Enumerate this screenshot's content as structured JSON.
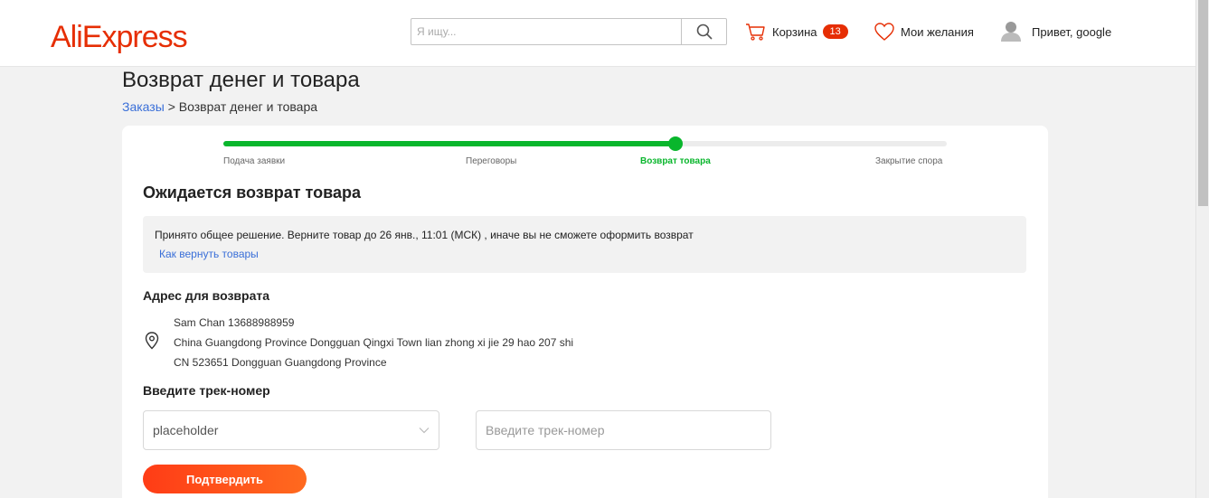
{
  "header": {
    "logo": "AliExpress",
    "search_placeholder": "Я ищу...",
    "cart_label": "Корзина",
    "cart_count": "13",
    "wishlist_label": "Мои желания",
    "greeting": "Привет, google"
  },
  "page": {
    "title": "Возврат денег и товара",
    "breadcrumb_link": "Заказы",
    "breadcrumb_separator": ">",
    "breadcrumb_current": "Возврат денег и товара"
  },
  "progress": {
    "fraction": 0.625,
    "steps": [
      {
        "label": "Подача заявки",
        "active": false
      },
      {
        "label": "Переговоры",
        "active": false
      },
      {
        "label": "Возврат товара",
        "active": true
      },
      {
        "label": "Закрытие спора",
        "active": false
      }
    ]
  },
  "status": {
    "heading": "Ожидается возврат товара",
    "notice_text": "Принято общее решение. Верните товар до 26 янв., 11:01 (МСК) , иначе вы не сможете оформить возврат",
    "notice_link": "Как вернуть товары"
  },
  "address": {
    "title": "Адрес для возврата",
    "lines": [
      "Sam Chan 13688988959",
      "China Guangdong Province Dongguan Qingxi Town lian zhong xi jie 29 hao 207 shi",
      "CN 523651 Dongguan Guangdong Province"
    ]
  },
  "tracking": {
    "title": "Введите трек-номер",
    "select_value": "placeholder",
    "input_placeholder": "Введите трек-номер",
    "confirm_label": "Подтвердить"
  },
  "colors": {
    "brand": "#e62e04",
    "progress": "#09b62c",
    "link": "#3a6fd8"
  }
}
